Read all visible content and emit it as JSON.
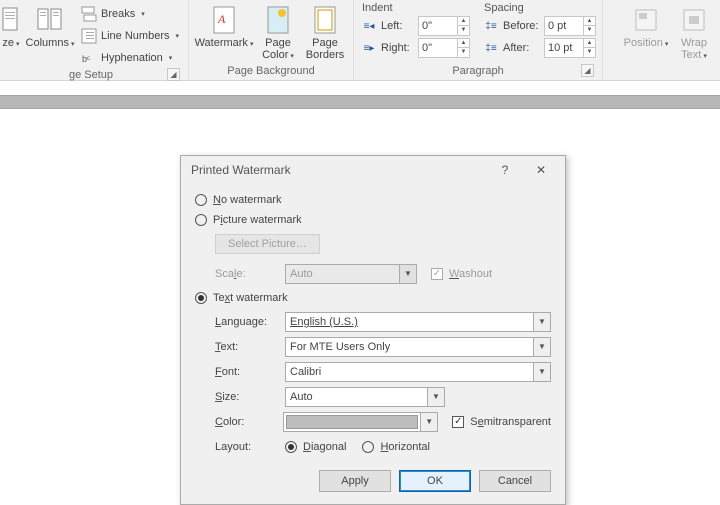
{
  "ribbon": {
    "pageSetup": {
      "label": "ge Setup",
      "size": "ze",
      "columns": "Columns",
      "breaks": "Breaks",
      "lineNumbers": "Line Numbers",
      "hyphenation": "Hyphenation"
    },
    "pageBackground": {
      "label": "Page Background",
      "watermark": "Watermark",
      "pageColor": "Page\nColor",
      "pageBorders": "Page\nBorders"
    },
    "paragraph": {
      "label": "Paragraph",
      "indent": "Indent",
      "left": "Left:",
      "right": "Right:",
      "leftVal": "0\"",
      "rightVal": "0\"",
      "spacing": "Spacing",
      "before": "Before:",
      "after": "After:",
      "beforeVal": "0 pt",
      "afterVal": "10 pt"
    },
    "arrange": {
      "position": "Position",
      "wrapText": "Wrap\nText"
    }
  },
  "dialog": {
    "title": "Printed Watermark",
    "noWatermark": "No watermark",
    "pictureWatermark": "Picture watermark",
    "selectPicture": "Select Picture…",
    "scale": "Scale:",
    "scaleVal": "Auto",
    "washout": "Washout",
    "textWatermark": "Text watermark",
    "language": "Language:",
    "languageVal": "English (U.S.)",
    "text": "Text:",
    "textVal": "For MTE Users Only",
    "font": "Font:",
    "fontVal": "Calibri",
    "size": "Size:",
    "sizeVal": "Auto",
    "color": "Color:",
    "semitransparent": "Semitransparent",
    "layout": "Layout:",
    "diagonal": "Diagonal",
    "horizontal": "Horizontal",
    "apply": "Apply",
    "ok": "OK",
    "cancel": "Cancel"
  }
}
